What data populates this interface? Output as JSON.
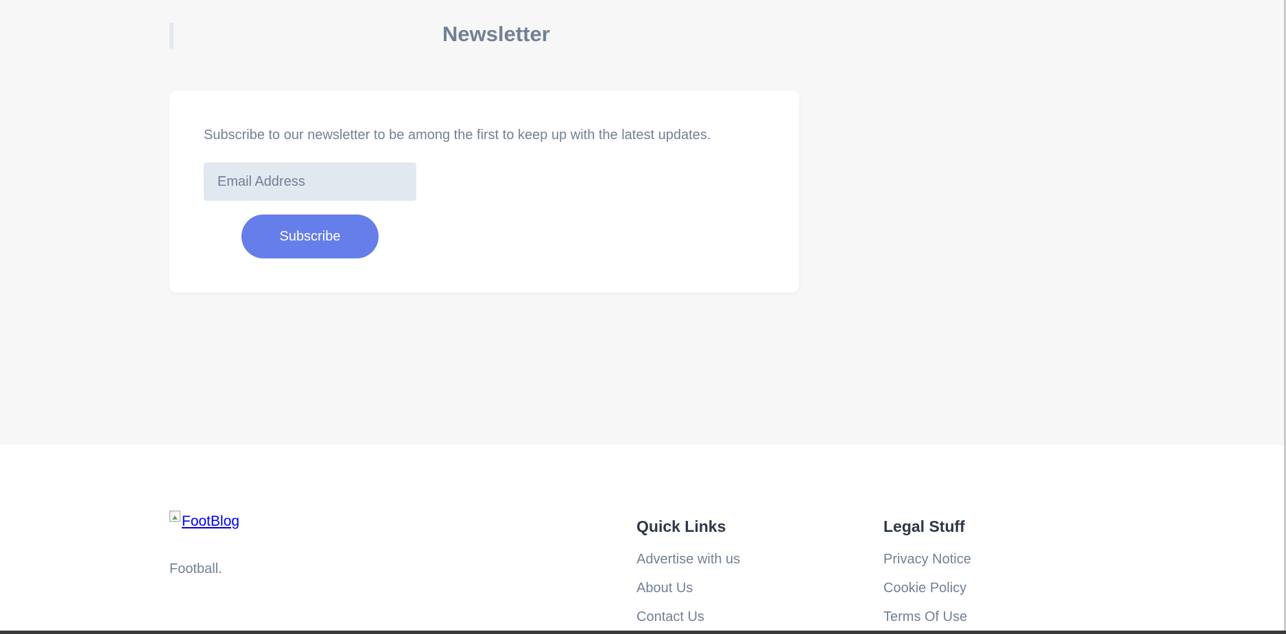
{
  "newsletter": {
    "title": "Newsletter",
    "description": "Subscribe to our newsletter to be among the first to keep up with the latest updates.",
    "email_placeholder": "Email Address",
    "subscribe_label": "Subscribe"
  },
  "footer": {
    "logo_alt": "FootBlog",
    "tagline": "Football.",
    "quick_links": {
      "heading": "Quick Links",
      "items": [
        "Advertise with us",
        "About Us",
        "Contact Us"
      ]
    },
    "legal": {
      "heading": "Legal Stuff",
      "items": [
        "Privacy Notice",
        "Cookie Policy",
        "Terms Of Use"
      ]
    }
  },
  "colors": {
    "accent": "#667eea",
    "muted_text": "#718096",
    "heading_text": "#2d3748",
    "input_bg": "#e2e8f0",
    "section_bg": "#f7f7f7",
    "link": "#0000ee"
  }
}
